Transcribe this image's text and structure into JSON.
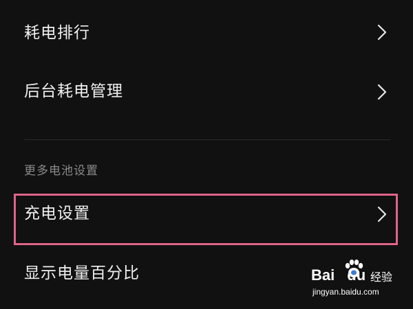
{
  "settings_list": {
    "items": [
      {
        "label": "耗电排行",
        "has_chevron": true
      },
      {
        "label": "后台耗电管理",
        "has_chevron": true
      }
    ],
    "section_header": "更多电池设置",
    "section_items": [
      {
        "label": "充电设置",
        "has_chevron": true,
        "highlighted": true
      },
      {
        "label": "显示电量百分比",
        "has_chevron": false
      }
    ]
  },
  "watermark": {
    "logo_text": "Bai",
    "logo_suffix": "du",
    "product": "经验",
    "url": "jingyan.baidu.com"
  },
  "colors": {
    "background": "#111111",
    "text": "#f0f0f0",
    "section_header": "#8a8a8a",
    "divider": "#2c2c2c",
    "highlight_border": "#e0648a"
  },
  "icons": {
    "chevron": "chevron-right-icon",
    "paw": "baidu-paw-icon"
  }
}
